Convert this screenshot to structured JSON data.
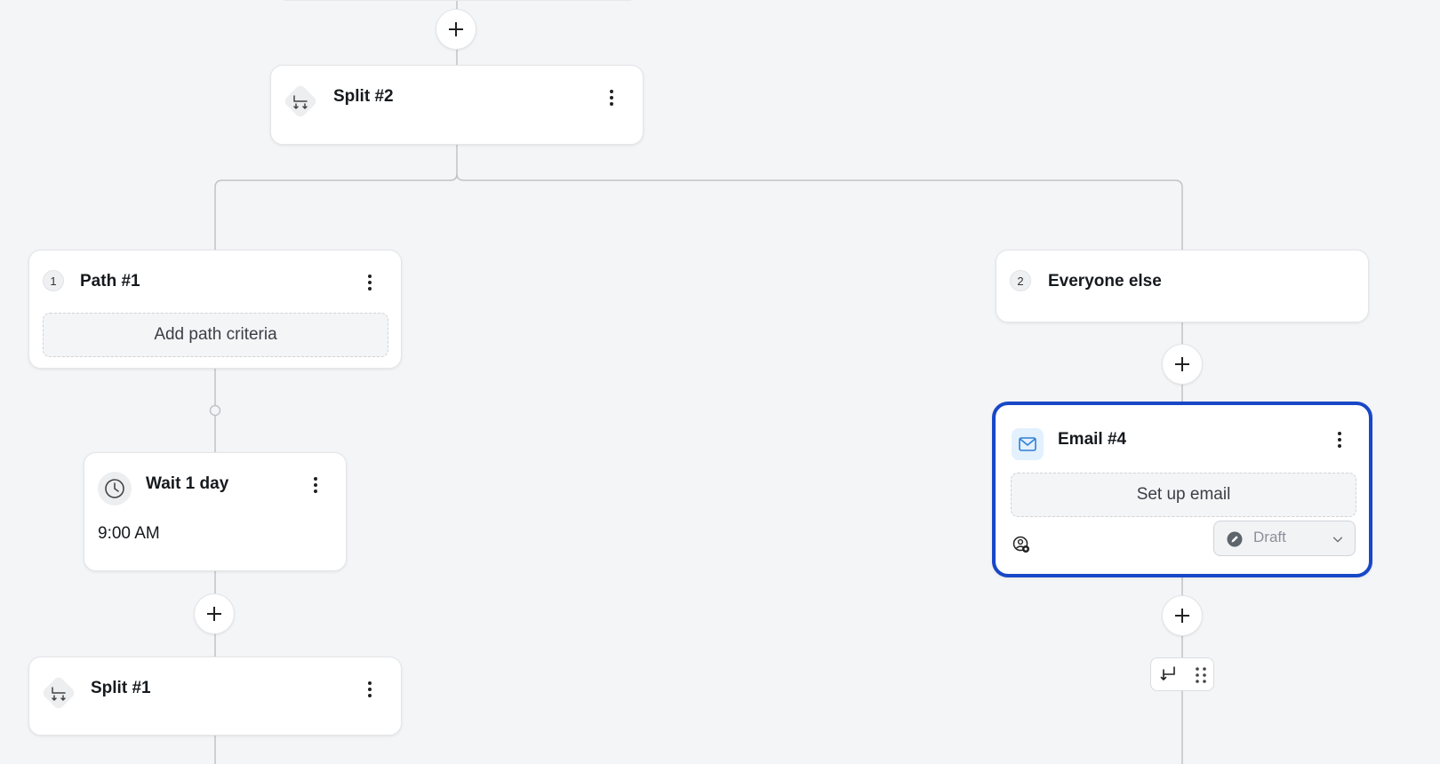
{
  "nodes": {
    "split2": {
      "title": "Split #2"
    },
    "path1": {
      "number": "1",
      "title": "Path #1",
      "criteria_button": "Add path criteria"
    },
    "everyone_else": {
      "number": "2",
      "title": "Everyone else"
    },
    "wait": {
      "title": "Wait 1 day",
      "time": "9:00 AM"
    },
    "split1": {
      "title": "Split #1"
    },
    "email4": {
      "title": "Email #4",
      "setup_button": "Set up email",
      "status": "Draft"
    }
  },
  "colors": {
    "canvas_bg": "#f4f5f7",
    "selected_border": "#1847c7",
    "connector": "#bfc3c8",
    "email_icon_bg": "#e3f0fd",
    "email_icon_fg": "#2f7fd6"
  }
}
